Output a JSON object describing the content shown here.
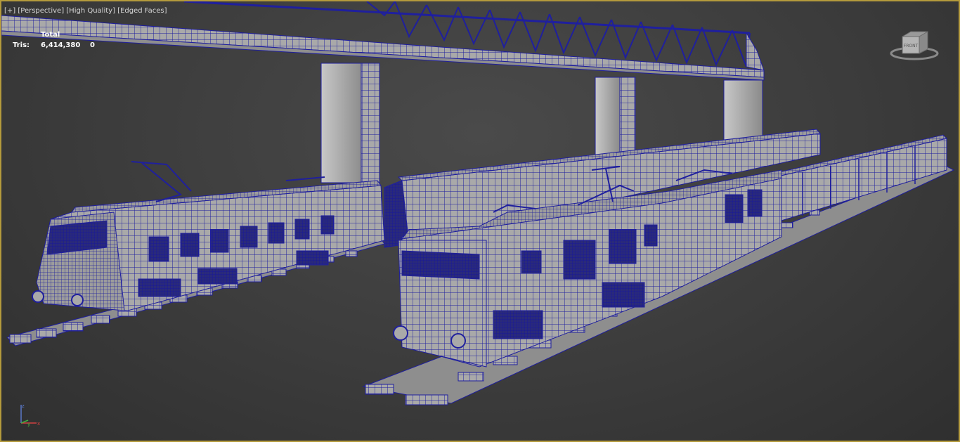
{
  "viewport": {
    "labels": [
      "[+]",
      "[Perspective]",
      "[High Quality]",
      "[Edged Faces]"
    ],
    "stats": {
      "header": "Total",
      "row_label": "Tris:",
      "total": "6,414,380",
      "selected": "0"
    },
    "viewcube_label": "FRONT"
  },
  "colors": {
    "wire": "#1f1f9e",
    "surface": "#a9a9a9",
    "background": "#3c3c3c",
    "border": "#b49a3c"
  }
}
